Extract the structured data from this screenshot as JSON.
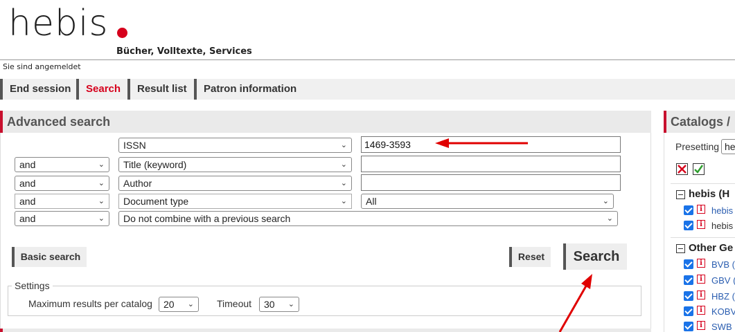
{
  "header": {
    "logo": "hebis",
    "tagline": "Bücher, Volltexte, Services",
    "login_status": "Sie sind angemeldet"
  },
  "nav": {
    "items": [
      {
        "label": "End session"
      },
      {
        "label": "Search",
        "active": true
      },
      {
        "label": "Result list"
      },
      {
        "label": "Patron information"
      }
    ]
  },
  "advanced_search": {
    "title": "Advanced search",
    "rows": [
      {
        "operator": "",
        "field": "ISSN",
        "value": "1469-3593"
      },
      {
        "operator": "and",
        "field": "Title (keyword)",
        "value": ""
      },
      {
        "operator": "and",
        "field": "Author",
        "value": ""
      },
      {
        "operator": "and",
        "field": "Document type",
        "value": "All"
      },
      {
        "operator": "and",
        "field": "Do not combine with a previous search"
      }
    ],
    "basic_search_label": "Basic search",
    "reset_label": "Reset",
    "search_label": "Search",
    "settings": {
      "legend": "Settings",
      "max_results_label": "Maximum results per catalog",
      "max_results_value": "20",
      "timeout_label": "Timeout",
      "timeout_value": "30"
    }
  },
  "catalogs": {
    "title": "Catalogs /",
    "presetting_label": "Presetting",
    "presetting_value": "he",
    "groups": [
      {
        "label": "hebis (H",
        "items": [
          "hebis",
          "hebis"
        ]
      },
      {
        "label": "Other Ge",
        "items": [
          "BVB (",
          "GBV (",
          "HBZ (",
          "KOBV",
          "SWB"
        ]
      }
    ]
  },
  "colors": {
    "accent": "#d6001c",
    "annotation_arrow": "#e00000",
    "checkbox": "#1a73e8"
  }
}
